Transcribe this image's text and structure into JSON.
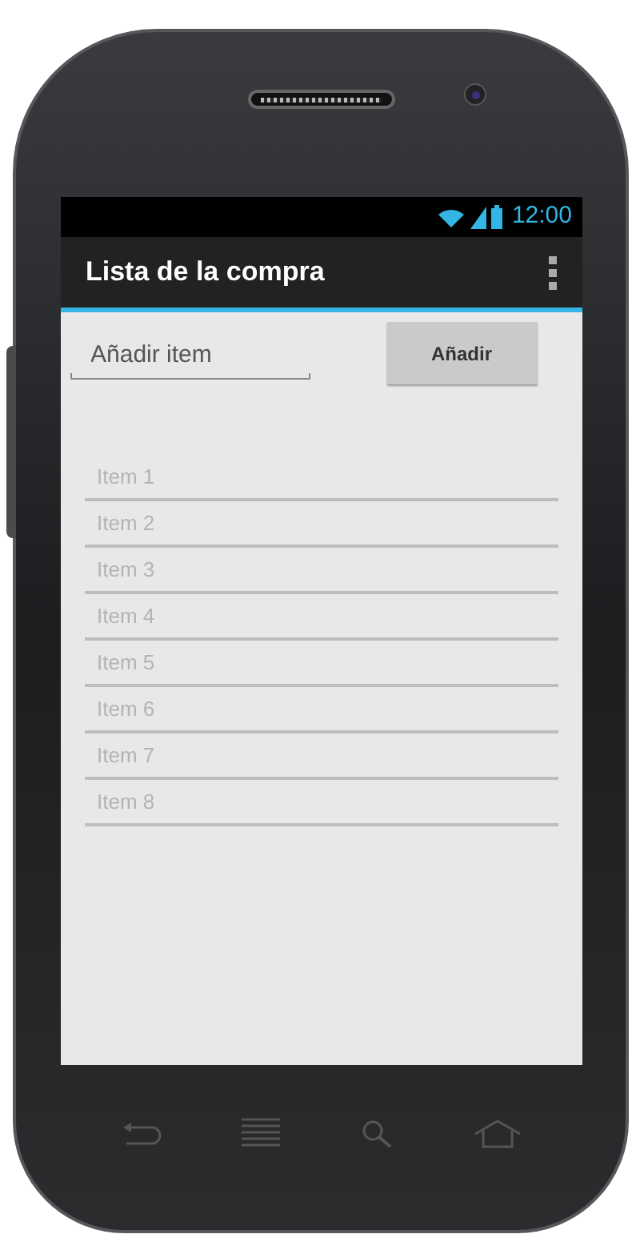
{
  "status_bar": {
    "time": "12:00"
  },
  "action_bar": {
    "title": "Lista de la compra"
  },
  "new_item": {
    "placeholder": "Añadir item"
  },
  "add_button": {
    "label": "Añadir"
  },
  "items": [
    {
      "label": "Item 1"
    },
    {
      "label": "Item 2"
    },
    {
      "label": "Item 3"
    },
    {
      "label": "Item 4"
    },
    {
      "label": "Item 5"
    },
    {
      "label": "Item 6"
    },
    {
      "label": "Item 7"
    },
    {
      "label": "Item 8"
    }
  ]
}
